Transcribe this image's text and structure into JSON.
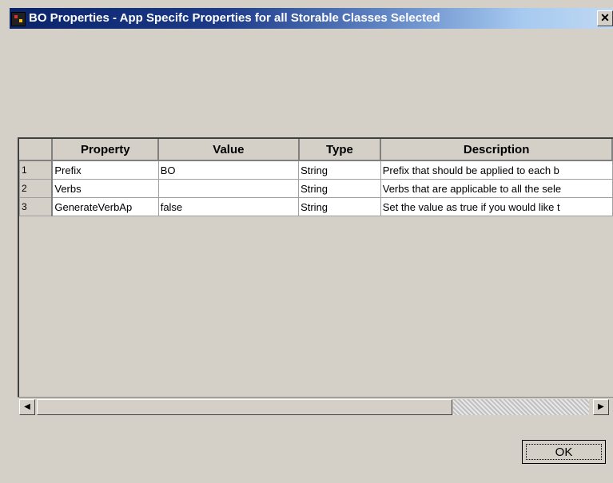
{
  "window": {
    "title": "BO Properties - App Specifc Properties for all Storable Classes Selected",
    "close_glyph": "✕"
  },
  "table": {
    "columns": [
      "",
      "Property",
      "Value",
      "Type",
      "Description"
    ],
    "rows": [
      {
        "num": "1",
        "property": "Prefix",
        "value": "BO",
        "type": "String",
        "description": "Prefix that should be applied to each b"
      },
      {
        "num": "2",
        "property": "Verbs",
        "value": "",
        "type": "String",
        "description": "Verbs that are applicable to all the sele"
      },
      {
        "num": "3",
        "property": "GenerateVerbAp",
        "value": "false",
        "type": "String",
        "description": "Set the value as true if you would like t"
      }
    ]
  },
  "scrollbar": {
    "left_arrow": "◀",
    "right_arrow": "▶"
  },
  "buttons": {
    "ok_label": "OK"
  },
  "icons": {
    "app": "app-icon",
    "close": "close-icon"
  }
}
